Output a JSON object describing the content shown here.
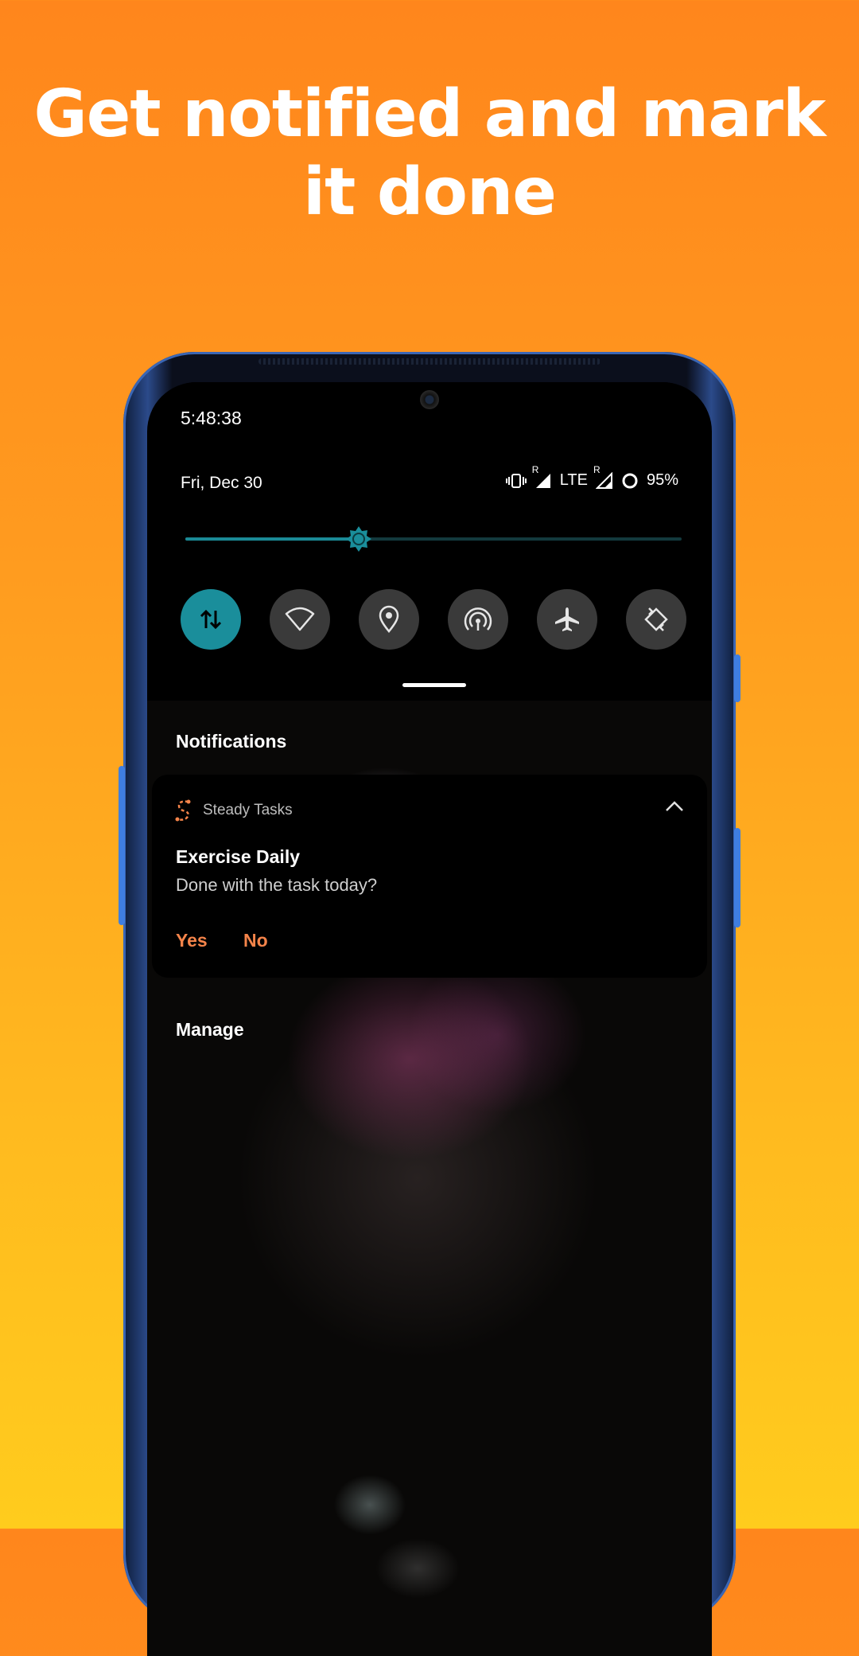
{
  "headline": {
    "line1": "Get notified and mark",
    "line2": "it done"
  },
  "status_bar": {
    "time": "5:48:38",
    "date": "Fri, Dec 30",
    "network": "LTE",
    "roaming_indicator": "R",
    "battery": "95%",
    "icons": [
      "vibrate-icon",
      "signal-icon",
      "signal-icon",
      "battery-ring-icon"
    ]
  },
  "brightness": {
    "level": 0.35,
    "accent_color": "#1a8e9b"
  },
  "quick_tiles": [
    {
      "icon": "mobile-data-icon",
      "active": true
    },
    {
      "icon": "wifi-icon",
      "active": false
    },
    {
      "icon": "location-icon",
      "active": false
    },
    {
      "icon": "hotspot-icon",
      "active": false
    },
    {
      "icon": "airplane-icon",
      "active": false
    },
    {
      "icon": "auto-rotate-icon",
      "active": false
    }
  ],
  "notifications_label": "Notifications",
  "notification": {
    "app_name": "Steady Tasks",
    "app_icon": "steady-tasks-icon",
    "title": "Exercise Daily",
    "body": "Done with the task today?",
    "actions": [
      "Yes",
      "No"
    ],
    "action_color": "#f5844a"
  },
  "manage_label": "Manage",
  "colors": {
    "background_top": "#ff861c",
    "background_bottom": "#ffcc1d"
  }
}
